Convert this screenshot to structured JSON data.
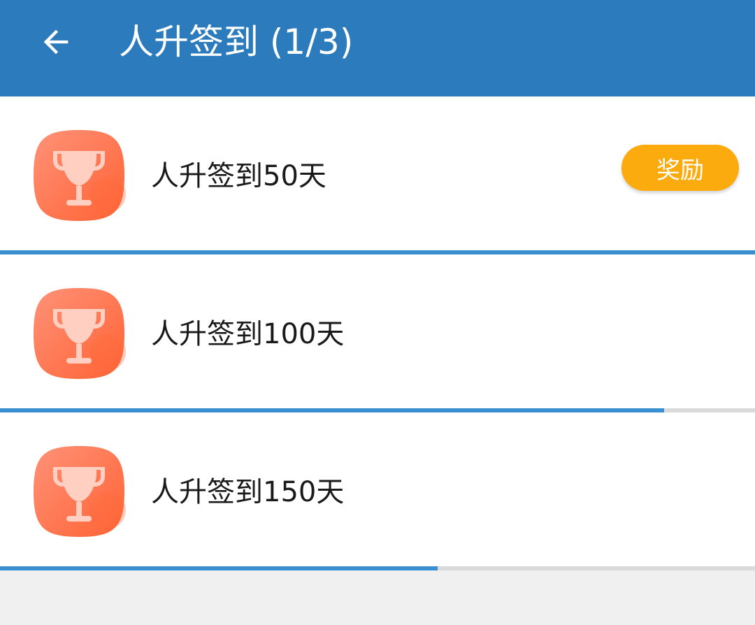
{
  "app_bar": {
    "title": "人升签到 (1/3)",
    "back_icon": "arrow-left-icon",
    "background": "#2b7bbd"
  },
  "achievements": [
    {
      "label": "人升签到50天",
      "icon": "trophy-icon",
      "progress": 1.0,
      "reward_label": "奖励"
    },
    {
      "label": "人升签到100天",
      "icon": "trophy-icon",
      "progress": 0.88
    },
    {
      "label": "人升签到150天",
      "icon": "trophy-icon",
      "progress": 0.58
    }
  ],
  "colors": {
    "accent": "#3a8fd0",
    "reward_button": "#fbab0d",
    "trophy_bg": "#ff7a5c"
  }
}
